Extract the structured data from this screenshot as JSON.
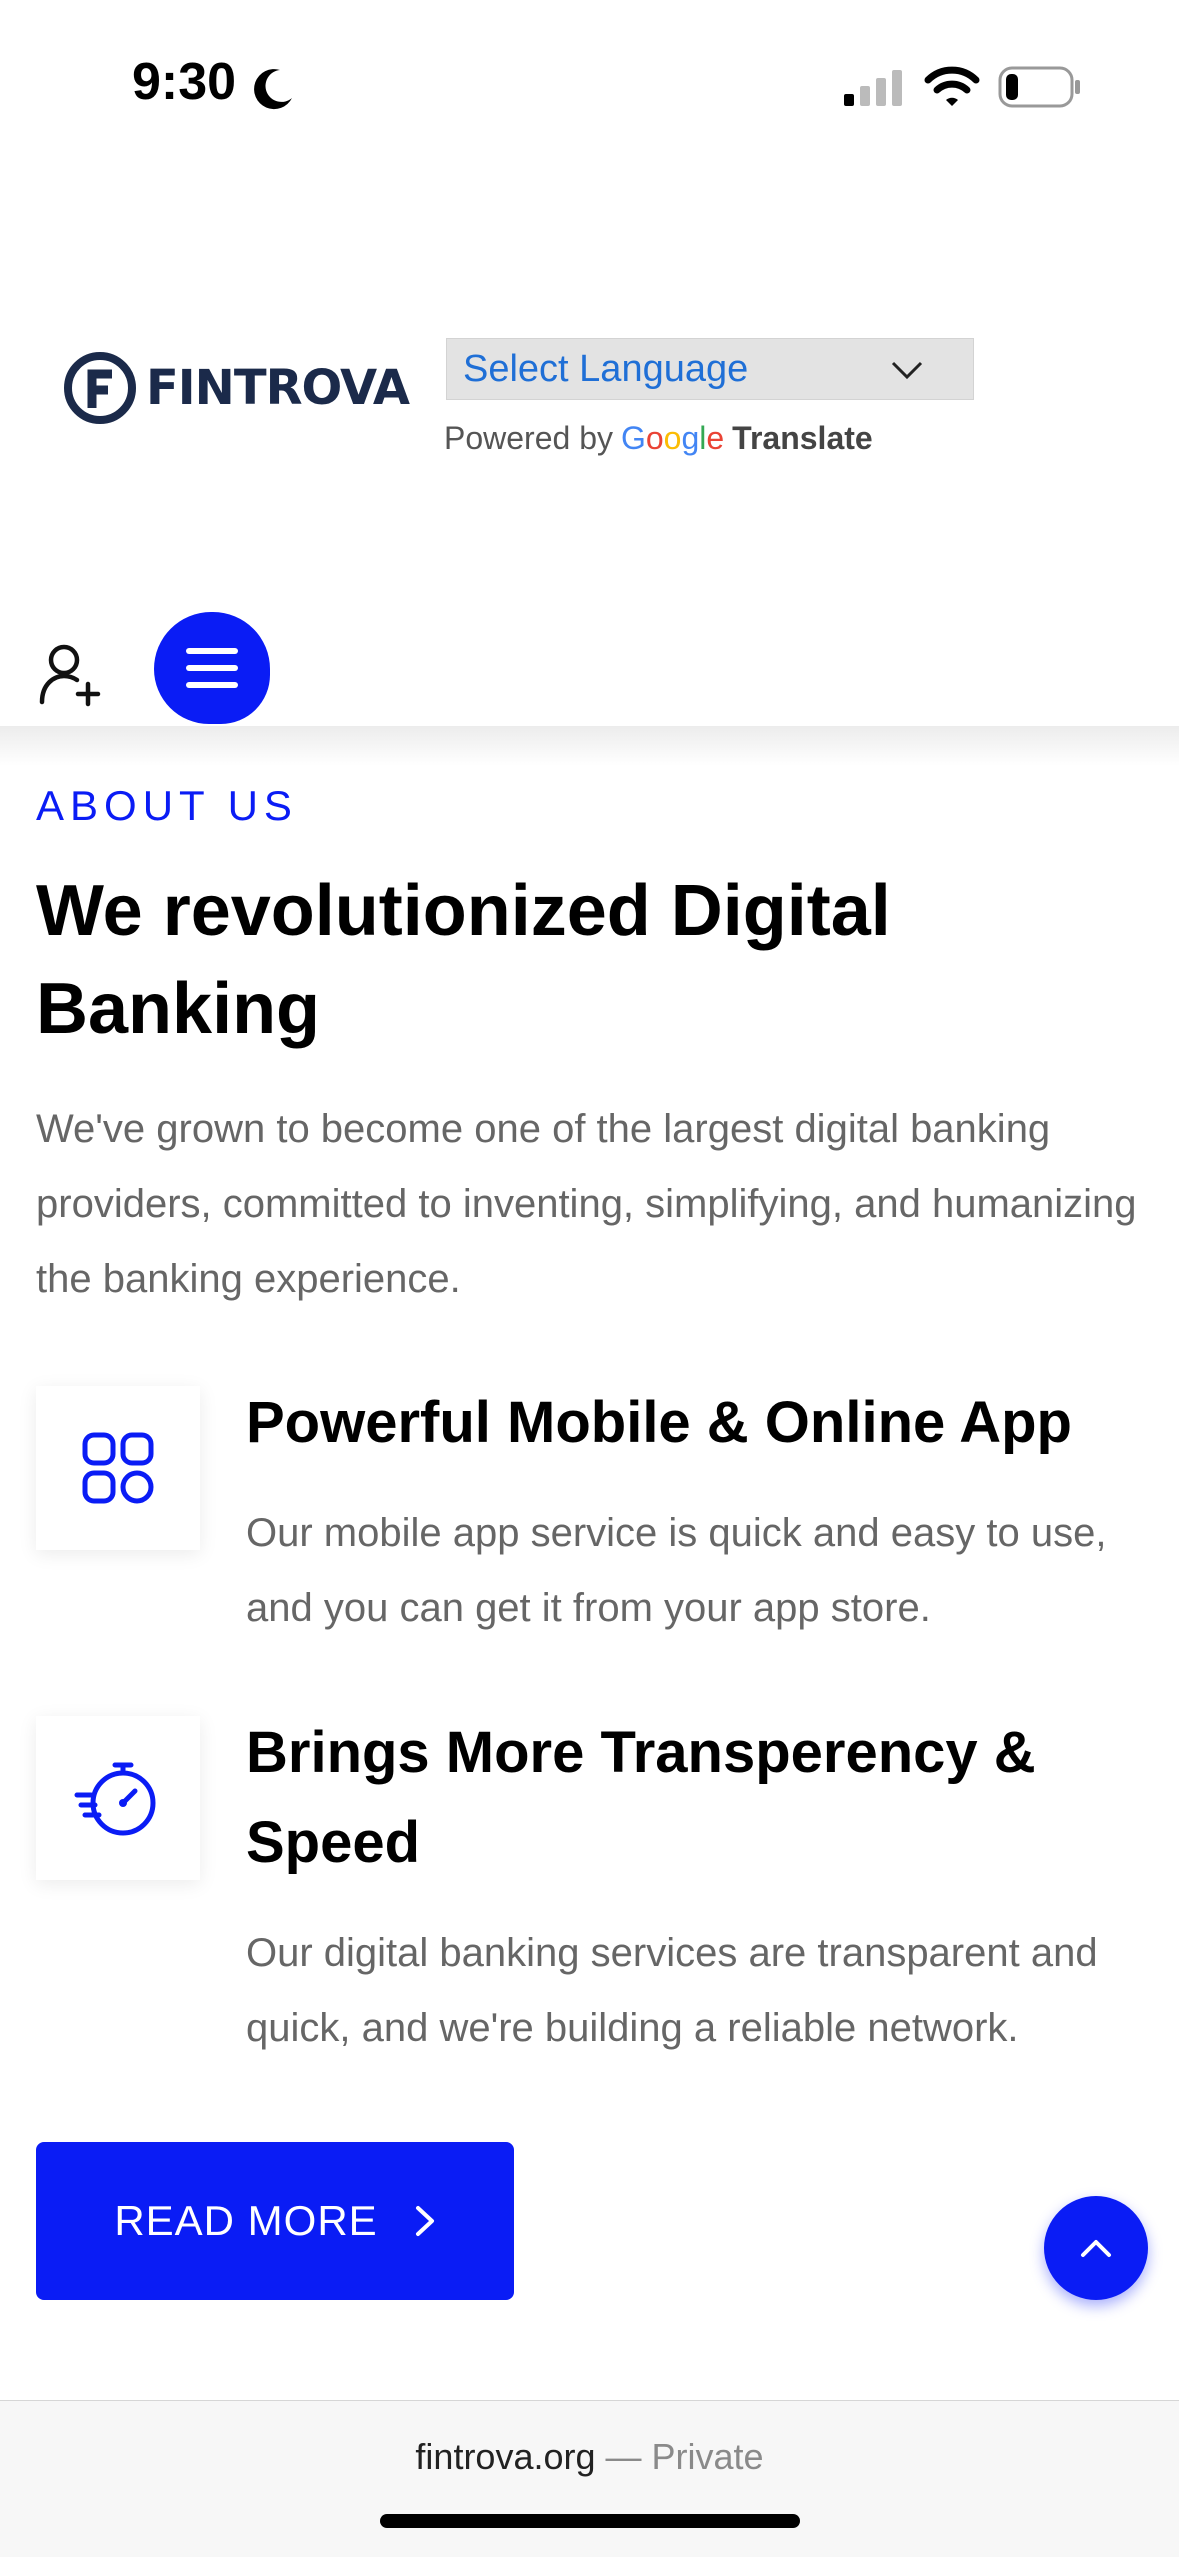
{
  "status_bar": {
    "time": "9:30"
  },
  "header": {
    "brand": "FINTROVA",
    "language_select": {
      "selected": "Select Language"
    },
    "powered_by": "Powered by",
    "google_letters": [
      "G",
      "o",
      "o",
      "g",
      "l",
      "e"
    ],
    "google_colors": [
      "#4285F4",
      "#EA4335",
      "#FBBC05",
      "#4285F4",
      "#34A853",
      "#EA4335"
    ],
    "translate": "Translate"
  },
  "icons": {
    "register": "user-plus-icon",
    "menu": "hamburger-icon",
    "feature1": "grid-icon",
    "feature2": "stopwatch-icon",
    "read_more": "chevron-right-icon",
    "scroll_top": "chevron-up-icon"
  },
  "about": {
    "eyebrow": "ABOUT US",
    "heading": "We revolutionized Digital Banking",
    "intro": "We've grown to become one of the largest digital banking providers, committed to inventing, simplifying, and humanizing the banking experience.",
    "features": [
      {
        "title": "Powerful Mobile & Online App",
        "description": "Our mobile app service is quick and easy to use, and you can get it from your app store."
      },
      {
        "title": "Brings More Transperency & Speed",
        "description": "Our digital banking services are transparent and quick, and we're building a reliable network."
      }
    ],
    "read_more_label": "READ MORE"
  },
  "browser": {
    "domain": "fintrova.org",
    "mode": "— Private"
  },
  "colors": {
    "accent": "#0a1cf5",
    "link": "#1f6fd6",
    "body_text": "#666666"
  }
}
